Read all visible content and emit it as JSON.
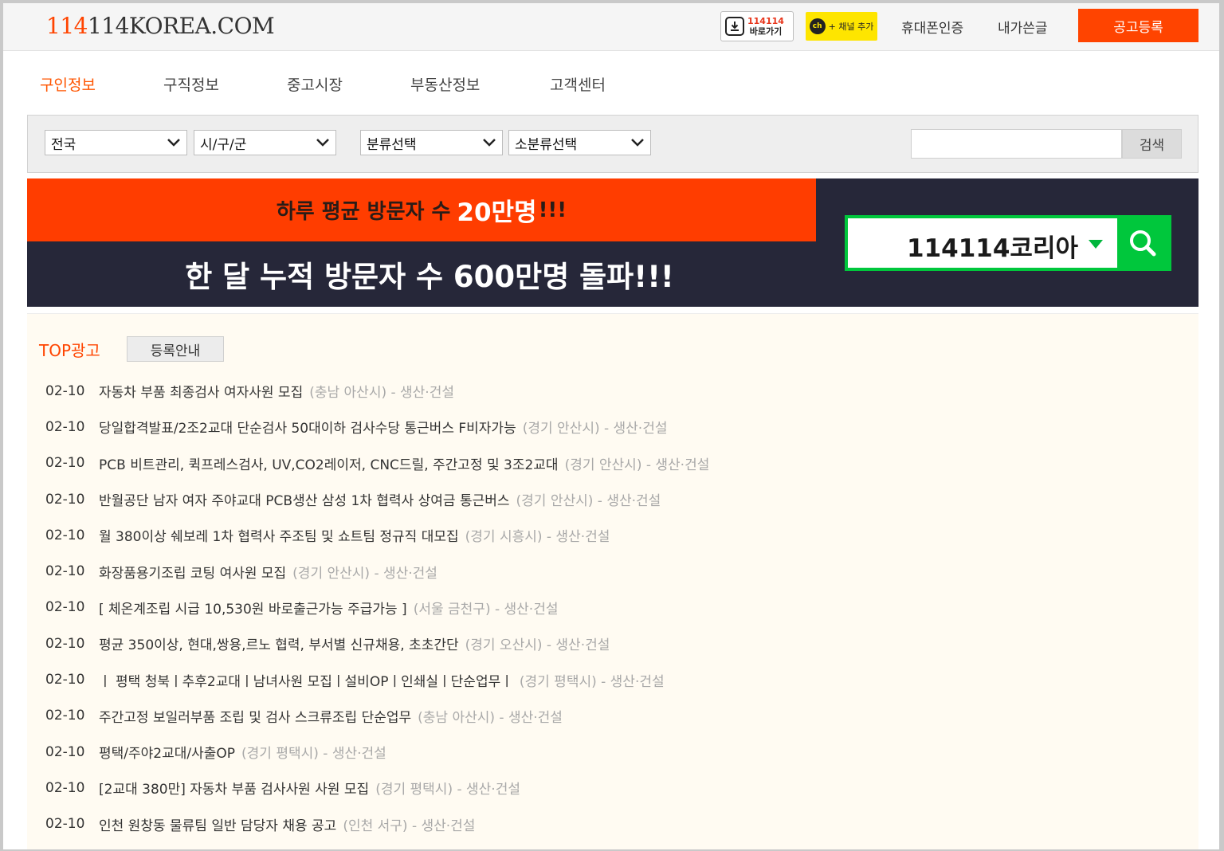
{
  "header": {
    "logo": {
      "prefix": "114",
      "rest": "114KOREA.COM"
    },
    "app_button": {
      "line1": "114114",
      "line2": "바로가기"
    },
    "kakao_button": {
      "icon_text": "ch",
      "label": "+ 채널 추가"
    },
    "links": [
      "휴대폰인증",
      "내가쓴글"
    ],
    "register_button": "공고등록"
  },
  "nav": {
    "tabs": [
      "구인정보",
      "구직정보",
      "중고시장",
      "부동산정보",
      "고객센터"
    ],
    "active_index": 0
  },
  "filters": {
    "selects": [
      "전국",
      "시/구/군",
      "분류선택",
      "소분류선택"
    ],
    "search_placeholder": "",
    "search_button": "검색"
  },
  "banner": {
    "top_text_before": "하루 평균 방문자 수",
    "top_highlight": "20만명",
    "top_text_after": "!!!",
    "bottom_text": "한 달 누적 방문자 수 600만명 돌파!!!",
    "search_keyword": "114114코리아"
  },
  "top_ads": {
    "title": "TOP광고",
    "guide_button": "등록안내",
    "items": [
      {
        "date": "02-10",
        "title": "자동차 부품 최종검사 여자사원 모집",
        "meta": "(충남 아산시) - 생산·건설"
      },
      {
        "date": "02-10",
        "title": "당일합격발표/2조2교대 단순검사 50대이하 검사수당 통근버스 F비자가능",
        "meta": "(경기 안산시) - 생산·건설"
      },
      {
        "date": "02-10",
        "title": "PCB 비트관리, 퀵프레스검사, UV,CO2레이저, CNC드릴, 주간고정 및 3조2교대",
        "meta": "(경기 안산시) - 생산·건설"
      },
      {
        "date": "02-10",
        "title": "반월공단 남자 여자 주야교대 PCB생산 삼성 1차 협력사 상여금 통근버스",
        "meta": "(경기 안산시) - 생산·건설"
      },
      {
        "date": "02-10",
        "title": "월 380이상 쉐보레 1차 협력사 주조팀 및 쇼트팀 정규직 대모집",
        "meta": "(경기 시흥시) - 생산·건설"
      },
      {
        "date": "02-10",
        "title": "화장품용기조립 코팅 여사원 모집",
        "meta": "(경기 안산시) - 생산·건설"
      },
      {
        "date": "02-10",
        "title": "[ 체온계조립 시급 10,530원 바로출근가능 주급가능 ]",
        "meta": "(서울 금천구) - 생산·건설"
      },
      {
        "date": "02-10",
        "title": "평균 350이상, 현대,쌍용,르노 협력, 부서별 신규채용, 초초간단",
        "meta": "(경기 오산시) - 생산·건설"
      },
      {
        "date": "02-10",
        "title": "ㅣ 평택 청북ㅣ추후2교대ㅣ남녀사원 모집ㅣ설비OPㅣ인쇄실ㅣ단순업무ㅣ",
        "meta": "(경기 평택시) - 생산·건설"
      },
      {
        "date": "02-10",
        "title": "주간고정 보일러부품 조립 및 검사 스크류조립 단순업무",
        "meta": "(충남 아산시) - 생산·건설"
      },
      {
        "date": "02-10",
        "title": "평택/주야2교대/사출OP",
        "meta": "(경기 평택시) - 생산·건설"
      },
      {
        "date": "02-10",
        "title": "[2교대 380만] 자동차 부품 검사사원 사원 모집",
        "meta": "(경기 평택시) - 생산·건설"
      },
      {
        "date": "02-10",
        "title": "인천 원창동 물류팀 일반 담당자 채용 공고",
        "meta": "(인천 서구) - 생산·건설"
      }
    ]
  },
  "colors": {
    "accent": "#ff4400",
    "kakao": "#fee500",
    "naver_green": "#00c73c",
    "banner_dark": "#262739"
  }
}
